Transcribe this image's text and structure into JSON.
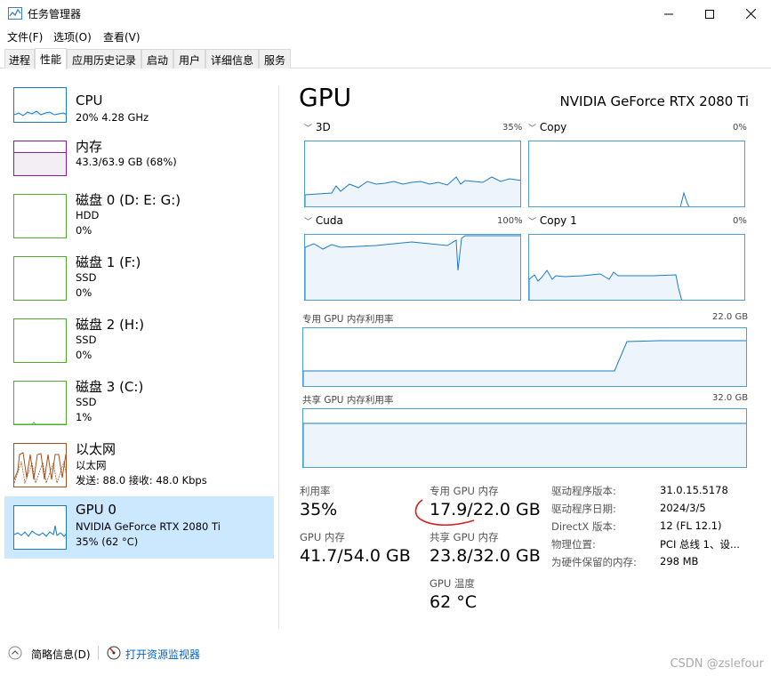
{
  "window": {
    "title": "任务管理器",
    "minimize_icon": "minimize-icon",
    "maximize_icon": "maximize-icon",
    "close_icon": "close-icon"
  },
  "menu": [
    "文件(F)",
    "选项(O)",
    "查看(V)"
  ],
  "tabs": [
    "进程",
    "性能",
    "应用历史记录",
    "启动",
    "用户",
    "详细信息",
    "服务"
  ],
  "active_tab": "性能",
  "sidebar": {
    "items": [
      {
        "name": "CPU",
        "line1": "20% 4.28 GHz",
        "line2": "",
        "color": "#1a7bc4",
        "level": 0.2
      },
      {
        "name": "内存",
        "line1": "43.3/63.9 GB (68%)",
        "line2": "",
        "color": "#8b1aa3",
        "level": 0.68
      },
      {
        "name": "磁盘 0 (D: E: G:)",
        "line1": "HDD",
        "line2": "0%",
        "color": "#4daf29",
        "level": 0
      },
      {
        "name": "磁盘 1 (F:)",
        "line1": "SSD",
        "line2": "0%",
        "color": "#4daf29",
        "level": 0
      },
      {
        "name": "磁盘 2 (H:)",
        "line1": "SSD",
        "line2": "0%",
        "color": "#4daf29",
        "level": 0
      },
      {
        "name": "磁盘 3 (C:)",
        "line1": "SSD",
        "line2": "1%",
        "color": "#4daf29",
        "level": 0.01
      },
      {
        "name": "以太网",
        "line1": "以太网",
        "line2": "发送: 88.0  接收: 48.0 Kbps",
        "color": "#a7521c",
        "level": 0.5
      },
      {
        "name": "GPU 0",
        "line1": "NVIDIA GeForce RTX 2080 Ti",
        "line2": "35% (62 °C)",
        "color": "#1a7bc4",
        "level": 0.35
      }
    ]
  },
  "gpu": {
    "title": "GPU",
    "model": "NVIDIA GeForce RTX 2080 Ti",
    "engines": [
      {
        "name": "3D",
        "max": "35%"
      },
      {
        "name": "Copy",
        "max": "0%"
      },
      {
        "name": "Cuda",
        "max": "100%"
      },
      {
        "name": "Copy 1",
        "max": "0%"
      }
    ],
    "dedicated_label": "专用 GPU 内存利用率",
    "dedicated_max": "22.0 GB",
    "shared_label": "共享 GPU 内存利用率",
    "shared_max": "32.0 GB",
    "stats": {
      "util_label": "利用率",
      "util_value": "35%",
      "ded_label": "专用 GPU 内存",
      "ded_value": "17.9/22.0 GB",
      "gpumem_label": "GPU 内存",
      "gpumem_value": "41.7/54.0 GB",
      "shared_label": "共享 GPU 内存",
      "shared_value": "23.8/32.0 GB",
      "temp_label": "GPU 温度",
      "temp_value": "62 °C"
    },
    "props": [
      {
        "label": "驱动程序版本:",
        "value": "31.0.15.5178"
      },
      {
        "label": "驱动程序日期:",
        "value": "2024/3/5"
      },
      {
        "label": "DirectX 版本:",
        "value": "12 (FL 12.1)"
      },
      {
        "label": "物理位置:",
        "value": "PCI 总线 1、设..."
      },
      {
        "label": "为硬件保留的内存:",
        "value": "298 MB"
      }
    ]
  },
  "footer": {
    "summary_label": "简略信息(D)",
    "monitor_label": "打开资源监视器"
  },
  "watermark": "CSDN @zslefour"
}
